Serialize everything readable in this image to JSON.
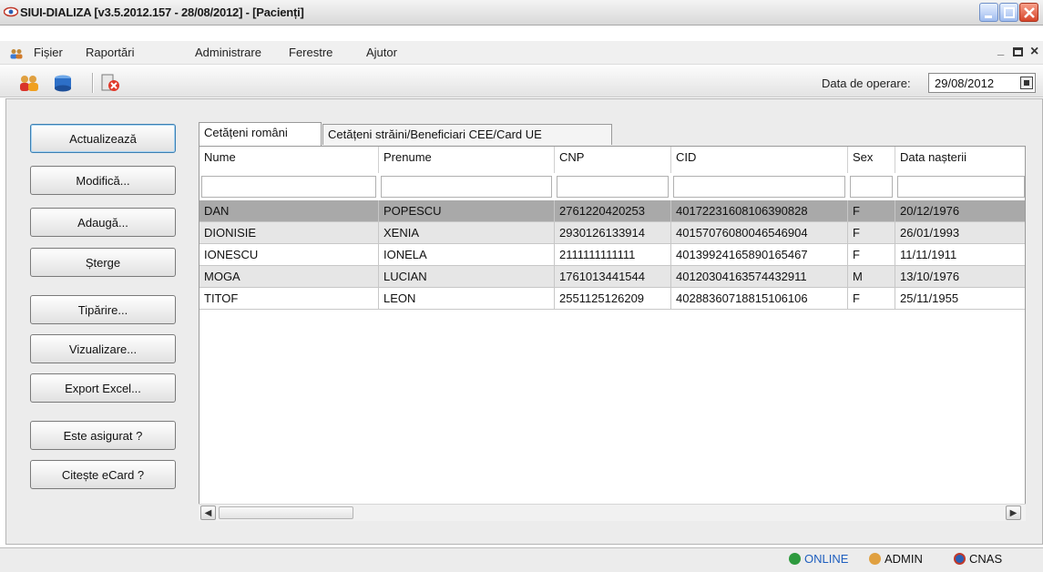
{
  "window": {
    "title": "SIUI-DIALIZA [v3.5.2012.157 - 28/08/2012] - [Pacienți]"
  },
  "menu": {
    "items": [
      "Fișier",
      "Raportări",
      "Administrare",
      "Ferestre",
      "Ajutor"
    ],
    "mdi_min": "_",
    "mdi_restore": "🗗",
    "mdi_close": "×"
  },
  "toolbar": {
    "icons": [
      "users-icon",
      "database-icon",
      "exit-icon"
    ],
    "date_label": "Data de operare:",
    "date_value": "29/08/2012"
  },
  "sidebar": {
    "buttons": [
      "Actualizează",
      "Modifică...",
      "Adaugă...",
      "Șterge",
      "Tipărire...",
      "Vizualizare...",
      "Export Excel...",
      "Este asigurat ?",
      "Citește eCard ?"
    ]
  },
  "tabs": [
    "Cetățeni români",
    "Cetățeni străini/Beneficiari CEE/Card UE"
  ],
  "grid": {
    "columns": [
      "Nume",
      "Prenume",
      "CNP",
      "CID",
      "Sex",
      "Data nașterii"
    ],
    "rows": [
      [
        "DAN",
        "POPESCU",
        "2761220420253",
        "40172231608106390828",
        "F",
        "20/12/1976"
      ],
      [
        "DIONISIE",
        "XENIA",
        "2930126133914",
        "40157076080046546904",
        "F",
        "26/01/1993"
      ],
      [
        "IONESCU",
        "IONELA",
        "2111111111111",
        "40139924165890165467",
        "F",
        "11/11/1911"
      ],
      [
        "MOGA",
        "LUCIAN",
        "1761013441544",
        "40120304163574432911",
        "M",
        "13/10/1976"
      ],
      [
        "TITOF",
        "LEON",
        "2551125126209",
        "40288360718815106106",
        "F",
        "25/11/1955"
      ]
    ]
  },
  "status": {
    "online": "ONLINE",
    "user": "ADMIN",
    "org": "CNAS"
  },
  "colors": {
    "selected_row": "#a9a9a9",
    "alt_row": "#e6e6e6",
    "online": "#1f5fbf"
  }
}
